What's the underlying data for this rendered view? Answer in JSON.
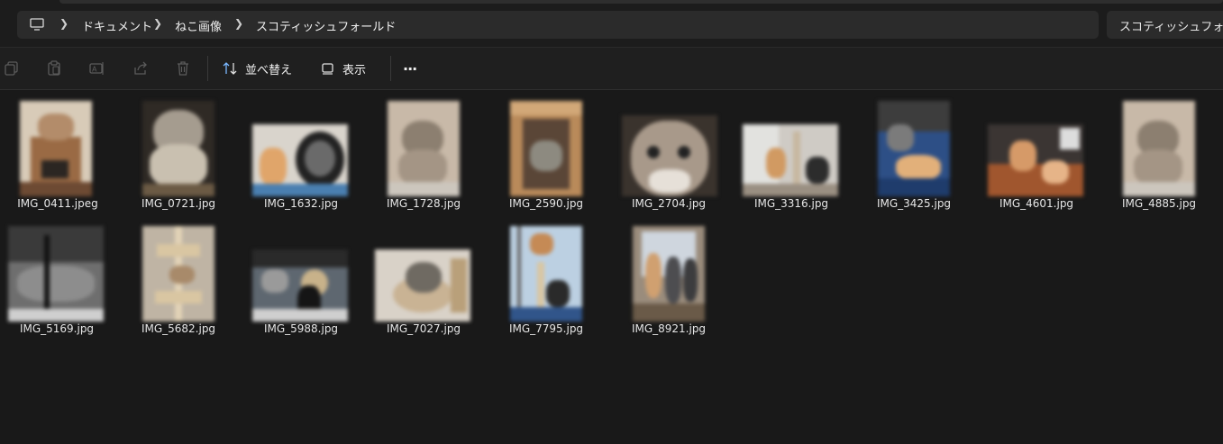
{
  "breadcrumb": {
    "items": [
      "ドキュメント",
      "ねこ画像",
      "スコティッシュフォールド"
    ]
  },
  "search": {
    "placeholder": "スコティッシュフォールドの検索"
  },
  "toolbar": {
    "sort_label": "並べ替え",
    "view_label": "表示",
    "more_label": "···"
  },
  "icons": {
    "pc": "computer-icon",
    "copy": "copy-icon",
    "paste": "paste-icon",
    "rename": "rename-icon",
    "share": "share-icon",
    "delete": "trash-icon",
    "sort": "sort-icon",
    "view": "view-icon",
    "more": "more-icon"
  },
  "colors": {
    "background": "#191919",
    "bar": "#2b2b2b",
    "text": "#e8e8e8"
  },
  "files": [
    {
      "name": "IMG_0411.jpeg"
    },
    {
      "name": "IMG_0721.jpg"
    },
    {
      "name": "IMG_1632.jpg"
    },
    {
      "name": "IMG_1728.jpg"
    },
    {
      "name": "IMG_2590.jpg"
    },
    {
      "name": "IMG_2704.jpg"
    },
    {
      "name": "IMG_3316.jpg"
    },
    {
      "name": "IMG_3425.jpg"
    },
    {
      "name": "IMG_4601.jpg"
    },
    {
      "name": "IMG_4885.jpg"
    },
    {
      "name": "IMG_5169.jpg"
    },
    {
      "name": "IMG_5682.jpg"
    },
    {
      "name": "IMG_5988.jpg"
    },
    {
      "name": "IMG_7027.jpg"
    },
    {
      "name": "IMG_7795.jpg"
    },
    {
      "name": "IMG_8921.jpg"
    }
  ]
}
